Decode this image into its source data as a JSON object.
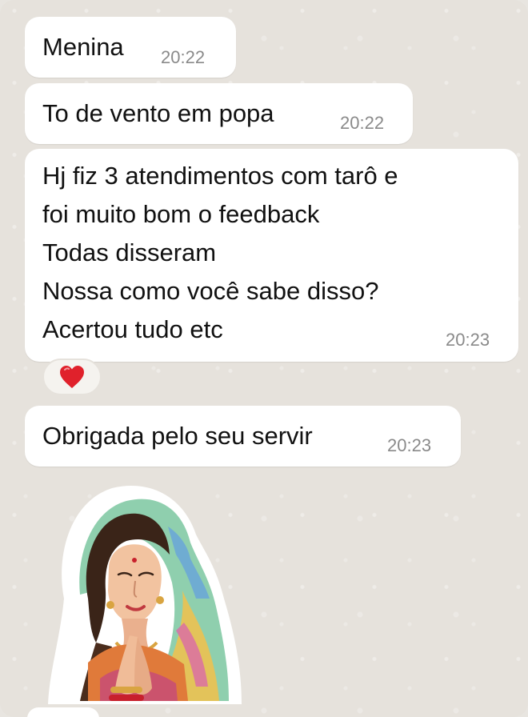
{
  "messages": [
    {
      "text": "Menina",
      "time": "20:22"
    },
    {
      "text": "To de vento em popa",
      "time": "20:22"
    },
    {
      "text": "Hj fiz 3 atendimentos com tarô e\nfoi muito bom o feedback\nTodas disseram\nNossa como você sabe disso?\nAcertou tudo etc",
      "time": "20:23"
    },
    {
      "text": "Obrigada pelo seu servir",
      "time": "20:23"
    }
  ],
  "reaction": {
    "icon": "red-heart-icon",
    "color": "#e0212b"
  },
  "sticker": {
    "icon": "praying-woman-sticker"
  },
  "colors": {
    "bubble": "#ffffff",
    "background": "#e6e2dc",
    "timestamp": "#8a8a8a"
  }
}
